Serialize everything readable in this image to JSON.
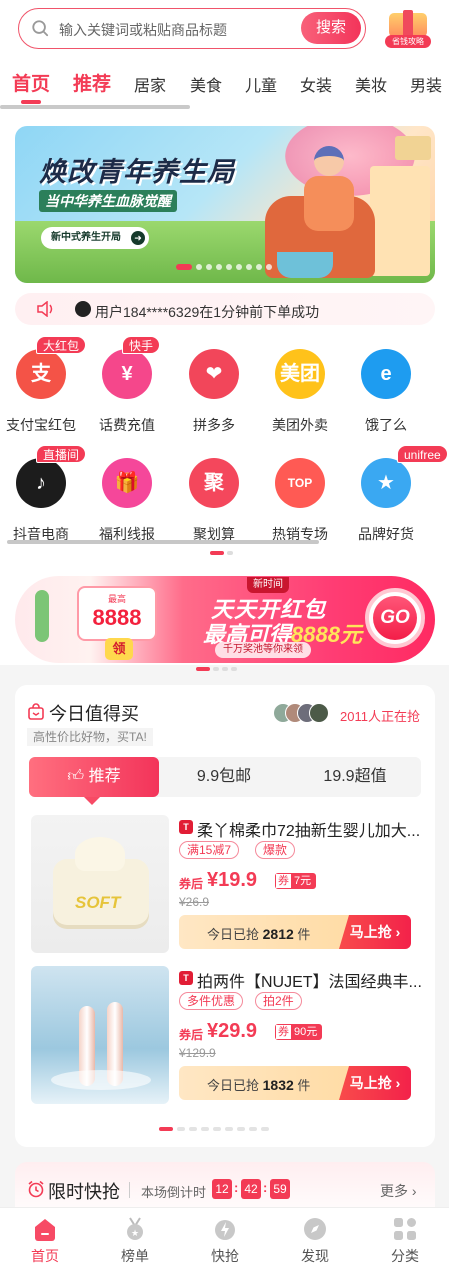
{
  "search": {
    "placeholder": "输入关键词或粘贴商品标题",
    "button": "搜索",
    "gift_label": "省钱攻略"
  },
  "categories": [
    "首页",
    "推荐",
    "居家",
    "美食",
    "儿童",
    "女装",
    "美妆",
    "男装"
  ],
  "banner": {
    "title": "焕改青年养生局",
    "subtitle": "当中华养生血脉觉醒",
    "cta": "新中式养生开局"
  },
  "notice": {
    "text": "用户184****6329在1分钟前下单成功"
  },
  "grid": [
    {
      "label": "支付宝红包",
      "badge": "大红包",
      "color": "#f45347",
      "glyph": "支"
    },
    {
      "label": "话费充值",
      "badge": "快手",
      "color": "#f5478b",
      "glyph": "¥"
    },
    {
      "label": "拼多多",
      "badge": "",
      "color": "#f2465a",
      "glyph": "❤"
    },
    {
      "label": "美团外卖",
      "badge": "",
      "color": "#ffc21a",
      "glyph": "美团"
    },
    {
      "label": "饿了么",
      "badge": "",
      "color": "#1e9cf0",
      "glyph": "e"
    },
    {
      "label": "抖音电商",
      "badge": "直播间",
      "color": "#1c1c1c",
      "glyph": "♪"
    },
    {
      "label": "福利线报",
      "badge": "",
      "color": "#f5479a",
      "glyph": "🎁"
    },
    {
      "label": "聚划算",
      "badge": "",
      "color": "#f4475c",
      "glyph": "聚"
    },
    {
      "label": "热销专场",
      "badge": "",
      "color": "#ff5a54",
      "glyph": "TOP"
    },
    {
      "label": "品牌好货",
      "badge": "unifree",
      "color": "#3aa8f2",
      "glyph": "★"
    }
  ],
  "redpacket": {
    "tag": "新时间",
    "card_label": "最高",
    "card_amount": "8888",
    "claim": "领",
    "line1": "天天开红包",
    "line2_prefix": "最高可得",
    "line2_amount": "8888元",
    "pill": "千万奖池等你来领",
    "go": "GO"
  },
  "deals": {
    "title": "今日值得买",
    "subtitle": "高性价比好物，买TA!",
    "people": "2011人正在抢",
    "tabs": [
      "推荐",
      "9.9包邮",
      "19.9超值"
    ],
    "products": [
      {
        "name": "柔丫棉柔巾72抽新生婴儿加大...",
        "tags": [
          "满15减7",
          "爆款"
        ],
        "price_label": "券后",
        "price": "¥19.9",
        "coupon": "7元",
        "coupon_mark": "券",
        "old_price": "¥26.9",
        "sold_prefix": "今日已抢",
        "sold": "2812",
        "sold_unit": "件",
        "buy": "马上抢"
      },
      {
        "name": "拍两件【NUJET】法国经典丰...",
        "tags": [
          "多件优惠",
          "拍2件"
        ],
        "price_label": "券后",
        "price": "¥29.9",
        "coupon": "90元",
        "coupon_mark": "券",
        "old_price": "¥129.9",
        "sold_prefix": "今日已抢",
        "sold": "1832",
        "sold_unit": "件",
        "buy": "马上抢"
      }
    ]
  },
  "flash": {
    "title": "限时快抢",
    "countdown_label": "本场倒计时",
    "hh": "12",
    "mm": "42",
    "ss": "59",
    "more": "更多 ›"
  },
  "nav": [
    "首页",
    "榜单",
    "快抢",
    "发现",
    "分类"
  ],
  "colors": {
    "accent": "#f33b55",
    "accent_gradient_end": "#f3345a"
  }
}
